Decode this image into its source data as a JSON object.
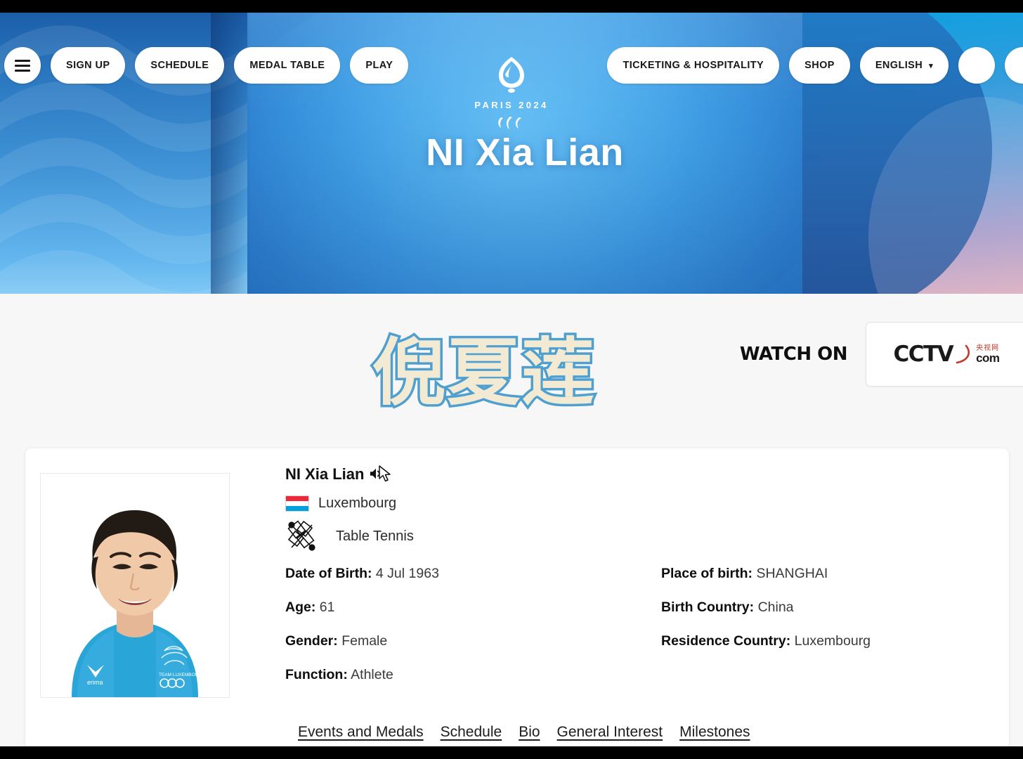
{
  "nav": {
    "menu_icon": "hamburger-menu-icon",
    "left_items": [
      {
        "label": "SIGN UP",
        "name": "sign-up"
      },
      {
        "label": "SCHEDULE",
        "name": "schedule"
      },
      {
        "label": "MEDAL TABLE",
        "name": "medal-table"
      },
      {
        "label": "PLAY",
        "name": "play"
      }
    ],
    "right_items": [
      {
        "label": "TICKETING & HOSPITALITY",
        "name": "ticketing-hospitality"
      },
      {
        "label": "SHOP",
        "name": "shop"
      },
      {
        "label": "ENGLISH",
        "name": "language-selector",
        "caret": "∨"
      }
    ]
  },
  "brand": {
    "logo_text": "PARIS 2024",
    "flame_icon": "paris2024-flame-icon",
    "agitos_icon": "paralympic-agitos-icon"
  },
  "hero": {
    "title": "NI Xia Lian"
  },
  "overlay": {
    "cjk_name": "倪夏莲",
    "cjk_fill_color": "#f2ead3",
    "cjk_stroke_color": "#4f9fcf"
  },
  "broadcaster": {
    "watch_on_label": "WATCH ON",
    "logo_main": "CCTV",
    "logo_cn": "央视网",
    "logo_com": "com",
    "accent_color": "#c0392b"
  },
  "athlete": {
    "name": "NI Xia Lian",
    "audio_icon": "speaker-pronunciation-icon",
    "cursor_icon": "mouse-cursor-icon",
    "portrait_alt": "athlete-portrait",
    "country": "Luxembourg",
    "flag_icon": "luxembourg-flag-icon",
    "sport": "Table Tennis",
    "sport_icon": "table-tennis-pictogram-icon",
    "facts_left": [
      {
        "label": "Date of Birth:",
        "value": "4 Jul 1963",
        "name": "date-of-birth"
      },
      {
        "label": "Age:",
        "value": "61",
        "name": "age"
      },
      {
        "label": "Gender:",
        "value": "Female",
        "name": "gender"
      },
      {
        "label": "Function:",
        "value": "Athlete",
        "name": "function"
      }
    ],
    "facts_right": [
      {
        "label": "Place of birth:",
        "value": "SHANGHAI",
        "name": "place-of-birth"
      },
      {
        "label": "Birth Country:",
        "value": "China",
        "name": "birth-country"
      },
      {
        "label": "Residence Country:",
        "value": "Luxembourg",
        "name": "residence-country"
      }
    ],
    "tabs": [
      {
        "label": "Events and Medals",
        "name": "events-and-medals"
      },
      {
        "label": "Schedule",
        "name": "schedule"
      },
      {
        "label": "Bio",
        "name": "bio"
      },
      {
        "label": "General Interest",
        "name": "general-interest"
      },
      {
        "label": "Milestones",
        "name": "milestones"
      }
    ]
  }
}
